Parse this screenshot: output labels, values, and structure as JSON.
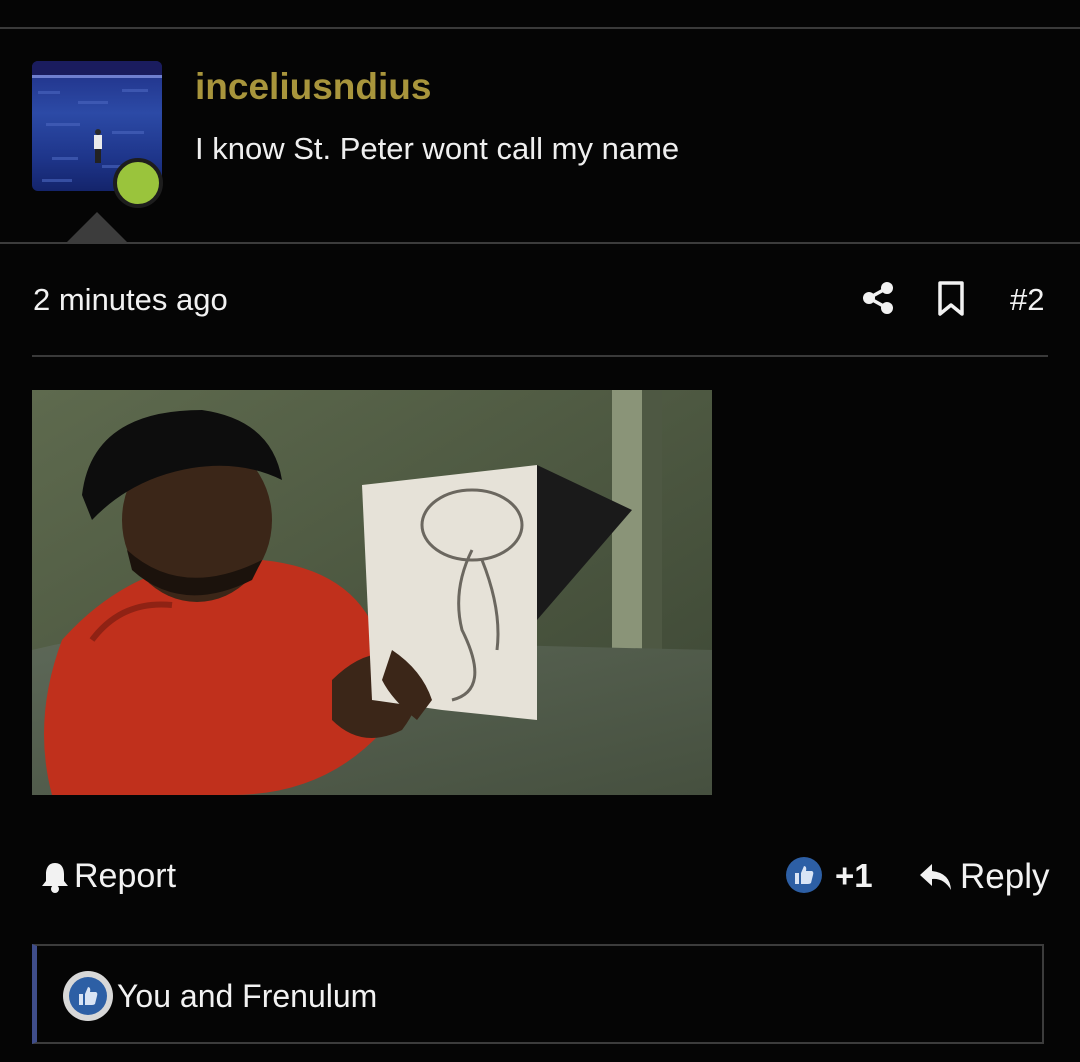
{
  "post": {
    "author": {
      "username": "inceliusndius",
      "user_title": "I know St. Peter wont call my name",
      "online": true
    },
    "timestamp": "2 minutes ago",
    "post_number": "#2",
    "actions": {
      "report_label": "Report",
      "reaction_count": "+1",
      "reply_label": "Reply"
    },
    "reactions_summary": "You and Frenulum"
  },
  "colors": {
    "username": "#a8953c",
    "online_indicator": "#9ac43c",
    "like_accent": "#2d5fa5",
    "reaction_bar_accent": "#3f4d8a",
    "background": "#050505"
  },
  "icons": {
    "share": "share-icon",
    "bookmark": "bookmark-icon",
    "report": "bell-icon",
    "like": "thumbs-up-icon",
    "reply": "reply-arrow-icon"
  }
}
